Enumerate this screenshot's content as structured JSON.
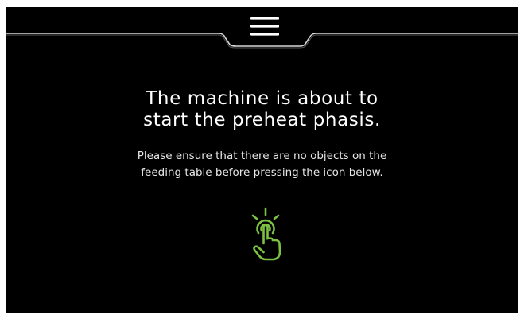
{
  "screen": {
    "title_line1": "The machine is about to",
    "title_line2": "start the preheat phasis.",
    "subtitle_line1": "Please ensure that there are no objects on the",
    "subtitle_line2": "feeding table before pressing the icon below."
  },
  "icons": {
    "menu": "hamburger-menu-icon",
    "start": "tap-finger-icon"
  },
  "colors": {
    "background": "#000000",
    "accent": "#7dc142",
    "text": "#ffffff"
  }
}
